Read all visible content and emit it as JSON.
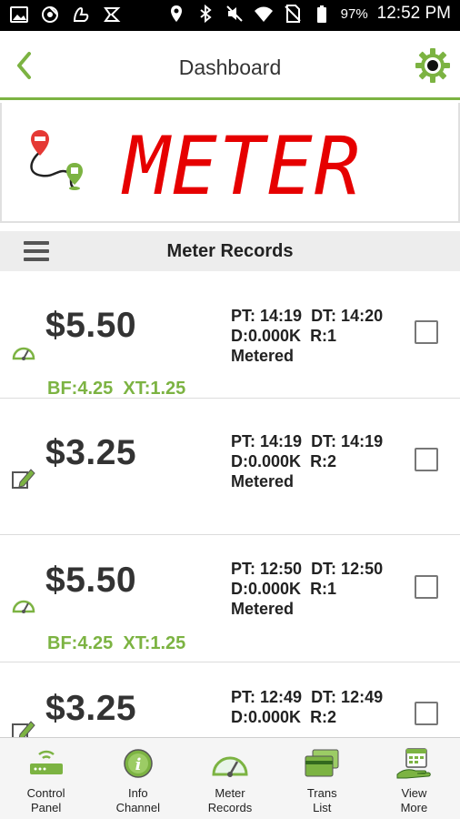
{
  "status_bar": {
    "battery": "97%",
    "time": "12:52 PM",
    "left_icons": [
      "image-icon",
      "chrome-icon",
      "pay-icon",
      "logo-icon"
    ],
    "right_icons": [
      "location-icon",
      "bluetooth-icon",
      "mute-icon",
      "wifi-icon",
      "no-sim-icon",
      "battery-icon"
    ]
  },
  "app_bar": {
    "title": "Dashboard",
    "back_icon": "chevron-left-icon",
    "settings_icon": "gear-icon"
  },
  "banner": {
    "display_text": "METER",
    "display_color": "#e60000"
  },
  "section": {
    "title": "Meter Records",
    "menu_icon": "hamburger-icon"
  },
  "records": [
    {
      "amount": "$5.50",
      "pt": "PT: 14:19",
      "dt": "DT: 14:20",
      "d": "D:0.000K",
      "r": "R:1",
      "mode": "Metered",
      "bf": "BF:4.25",
      "xt": "XT:1.25",
      "icon": "speedometer-icon",
      "checked": false
    },
    {
      "amount": "$3.25",
      "pt": "PT: 14:19",
      "dt": "DT: 14:19",
      "d": "D:0.000K",
      "r": "R:2",
      "mode": "Metered",
      "bf": "",
      "xt": "",
      "icon": "edit-icon",
      "checked": false
    },
    {
      "amount": "$5.50",
      "pt": "PT: 12:50",
      "dt": "DT: 12:50",
      "d": "D:0.000K",
      "r": "R:1",
      "mode": "Metered",
      "bf": "BF:4.25",
      "xt": "XT:1.25",
      "icon": "speedometer-icon",
      "checked": false
    },
    {
      "amount": "$3.25",
      "pt": "PT: 12:49",
      "dt": "DT: 12:49",
      "d": "D:0.000K",
      "r": "R:2",
      "mode": "",
      "bf": "",
      "xt": "",
      "icon": "edit-icon",
      "checked": false
    }
  ],
  "bottom_nav": [
    {
      "line1": "Control",
      "line2": "Panel",
      "icon": "router-icon"
    },
    {
      "line1": "Info",
      "line2": "Channel",
      "icon": "info-icon"
    },
    {
      "line1": "Meter",
      "line2": "Records",
      "icon": "speedometer-icon"
    },
    {
      "line1": "Trans",
      "line2": "List",
      "icon": "credit-card-icon"
    },
    {
      "line1": "View",
      "line2": "More",
      "icon": "calendar-hand-icon"
    }
  ],
  "colors": {
    "accent": "#7cb342",
    "meter_red": "#e60000"
  }
}
